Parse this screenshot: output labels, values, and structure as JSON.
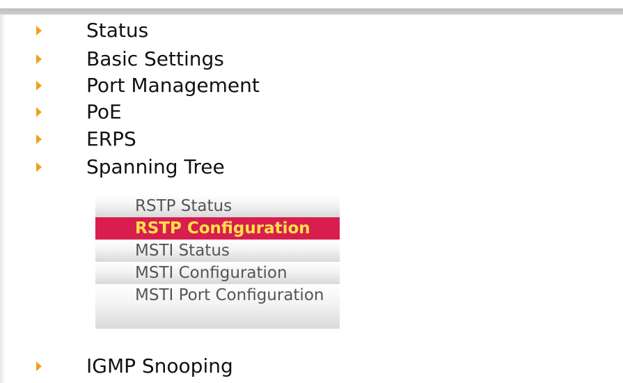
{
  "nav": {
    "items": [
      {
        "label": "Status"
      },
      {
        "label": "Basic Settings"
      },
      {
        "label": "Port Management"
      },
      {
        "label": "PoE"
      },
      {
        "label": "ERPS"
      },
      {
        "label": "Spanning Tree"
      },
      {
        "label": "IGMP Snooping"
      }
    ],
    "arrow_icon": "triangle-right-icon",
    "arrow_color": "#f0a020"
  },
  "submenu": {
    "items": [
      {
        "label": "RSTP Status",
        "active": false
      },
      {
        "label": "RSTP Configuration",
        "active": true
      },
      {
        "label": "MSTI Status",
        "active": false
      },
      {
        "label": "MSTI Configuration",
        "active": false
      },
      {
        "label": "MSTI Port Configuration",
        "active": false
      }
    ],
    "active_bg": "#d81e4e",
    "active_text": "#ffe14a"
  }
}
